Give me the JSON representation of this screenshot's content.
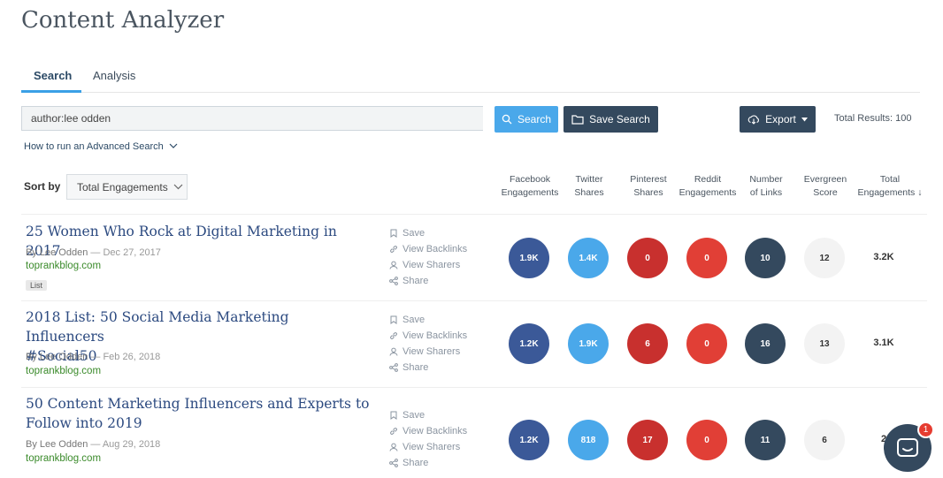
{
  "app": {
    "title": "Content Analyzer"
  },
  "tabs": [
    {
      "label": "Search",
      "active": true
    },
    {
      "label": "Analysis",
      "active": false
    }
  ],
  "search": {
    "value": "author:lee odden",
    "search_button": "Search",
    "save_button": "Save Search",
    "export_button": "Export",
    "total_results": "Total Results: 100",
    "advanced_link": "How to run an Advanced Search"
  },
  "sort": {
    "label": "Sort by",
    "selected": "Total Engagements"
  },
  "columns": {
    "facebook": [
      "Facebook",
      "Engagements"
    ],
    "twitter": [
      "Twitter",
      "Shares"
    ],
    "pinterest": [
      "Pinterest",
      "Shares"
    ],
    "reddit": [
      "Reddit",
      "Engagements"
    ],
    "links": [
      "Number",
      "of Links"
    ],
    "evergreen": [
      "Evergreen",
      "Score"
    ],
    "total": [
      "Total",
      "Engagements"
    ]
  },
  "actions": {
    "save": "Save",
    "backlinks": "View Backlinks",
    "sharers": "View Sharers",
    "share": "Share"
  },
  "results": [
    {
      "title_lines": [
        "25 Women Who Rock at Digital Marketing in 2017"
      ],
      "author": "By Lee Odden",
      "date": " — Dec 27, 2017",
      "domain": "toprankblog.com",
      "tag": "List",
      "facebook": "1.9K",
      "twitter": "1.4K",
      "pinterest": "0",
      "reddit": "0",
      "links": "10",
      "evergreen": "12",
      "total": "3.2K"
    },
    {
      "title_lines": [
        "2018 List: 50 Social Media Marketing Influencers",
        "#Social50"
      ],
      "author": "By Lee Odden",
      "date": " — Feb 26, 2018",
      "domain": "toprankblog.com",
      "tag": "",
      "facebook": "1.2K",
      "twitter": "1.9K",
      "pinterest": "6",
      "reddit": "0",
      "links": "16",
      "evergreen": "13",
      "total": "3.1K"
    },
    {
      "title_lines": [
        "50 Content Marketing Influencers and Experts to",
        "Follow into 2019"
      ],
      "author": "By Lee Odden",
      "date": " — Aug 29, 2018",
      "domain": "toprankblog.com",
      "tag": "",
      "facebook": "1.2K",
      "twitter": "818",
      "pinterest": "17",
      "reddit": "0",
      "links": "11",
      "evergreen": "6",
      "total": "2"
    }
  ],
  "chat": {
    "badge": "1"
  },
  "colors": {
    "facebook": "#3b5998",
    "twitter": "#4aa8ea",
    "pinterest": "#c8302e",
    "reddit": "#e13f36",
    "links": "#34495e",
    "evergreen": "#f3f3f3"
  }
}
